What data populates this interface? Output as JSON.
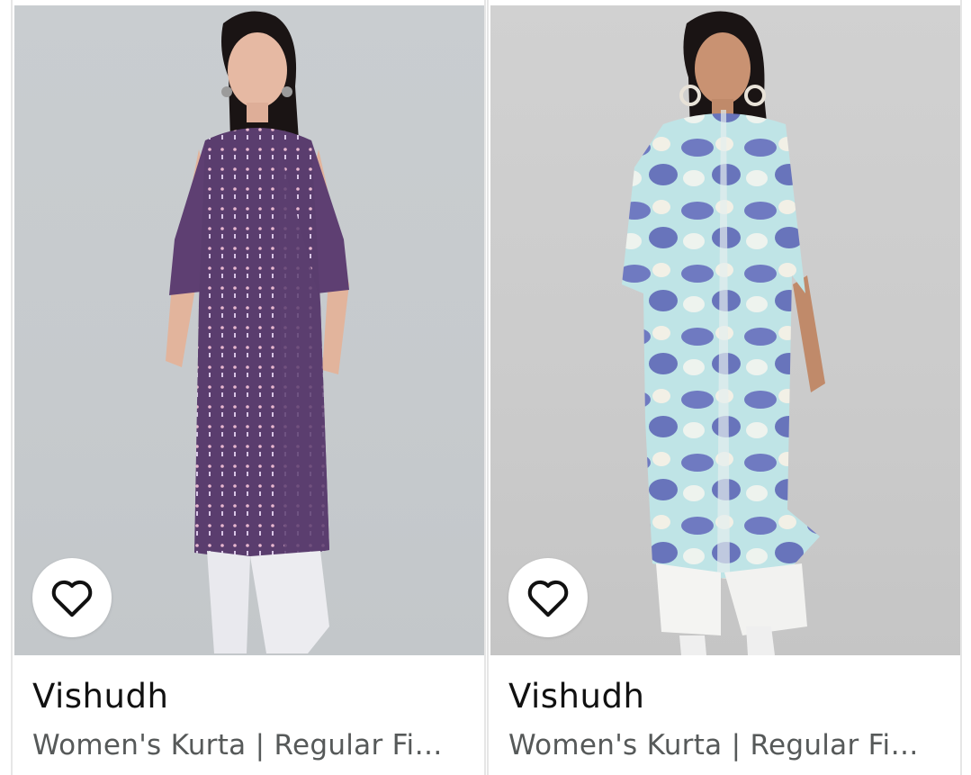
{
  "products": [
    {
      "brand": "Vishudh",
      "title": "Women's Kurta | Regular Fi…",
      "image_icon": "purple-kurta-model-photo",
      "wishlist_icon": "heart-outline-icon"
    },
    {
      "brand": "Vishudh",
      "title": "Women's Kurta | Regular Fi…",
      "image_icon": "tie-dye-kurta-model-photo",
      "wishlist_icon": "heart-outline-icon"
    }
  ],
  "colors": {
    "brand_text": "#111111",
    "title_text": "#565959",
    "card_border": "#e6e6e6"
  }
}
